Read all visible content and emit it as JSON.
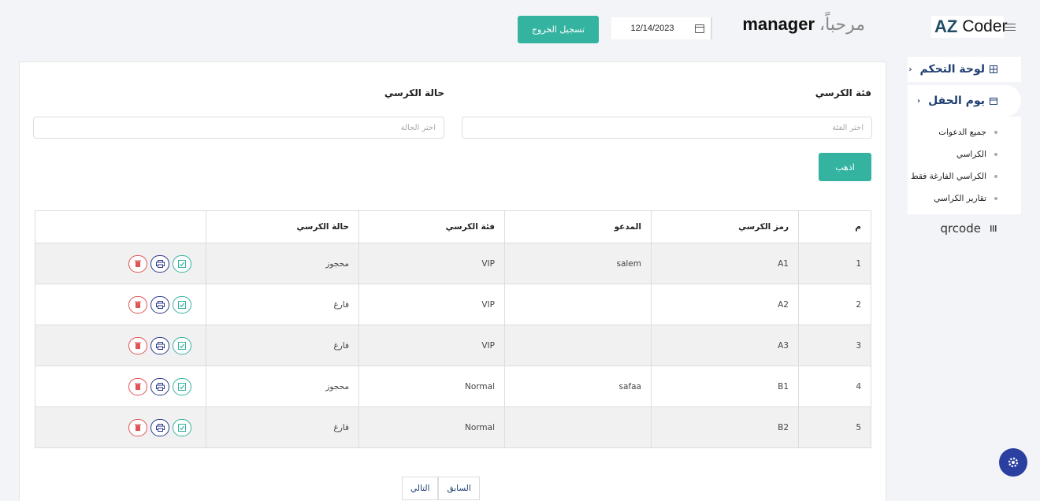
{
  "header": {
    "logo_az": "AZ",
    "logo_coder": "Coder",
    "greeting": "مرحباً،",
    "username": "manager",
    "date_value": "12/14/2023",
    "logout_label": "تسجيل الخروج"
  },
  "sidebar": {
    "dashboard_label": "لوحة التحكم",
    "event_label": "يوم الحفل",
    "submenu": [
      "جميع الدعوات",
      "الكراسي",
      "الكراسي الفارغة فقط",
      "تقارير الكراسي"
    ],
    "qr_label": "qrcode"
  },
  "filters": {
    "category_label": "فئة الكرسي",
    "category_placeholder": "اختر الفئة",
    "status_label": "حالة الكرسي",
    "status_placeholder": "اختر الحالة",
    "go_label": "اذهب"
  },
  "table": {
    "headers": [
      "م",
      "رمز الكرسي",
      "المدعو",
      "فئة الكرسي",
      "حالة الكرسي",
      ""
    ],
    "rows": [
      {
        "n": "1",
        "code": "A1",
        "guest": "salem",
        "cat": "VIP",
        "status": "محجوز"
      },
      {
        "n": "2",
        "code": "A2",
        "guest": "",
        "cat": "VIP",
        "status": "فارغ"
      },
      {
        "n": "3",
        "code": "A3",
        "guest": "",
        "cat": "VIP",
        "status": "فارغ"
      },
      {
        "n": "4",
        "code": "B1",
        "guest": "safaa",
        "cat": "Normal",
        "status": "محجوز"
      },
      {
        "n": "5",
        "code": "B2",
        "guest": "",
        "cat": "Normal",
        "status": "فارغ"
      }
    ]
  },
  "pager": {
    "prev_label": "السابق",
    "next_label": "التالي"
  },
  "colors": {
    "accent": "#34b3a0",
    "nav": "#1f3f73",
    "danger": "#e05555",
    "print": "#2b3a8a"
  }
}
